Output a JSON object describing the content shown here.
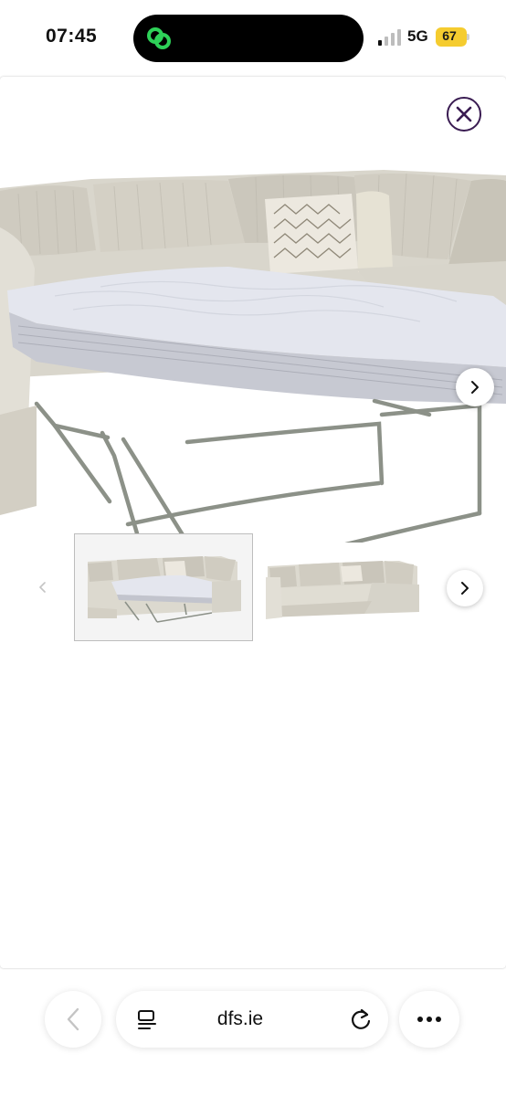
{
  "status_bar": {
    "time": "07:45",
    "network": "5G",
    "battery_level": "67",
    "battery_color": "#f5cc2f",
    "activity_icon": "link-rings-icon",
    "activity_color": "#2ed158"
  },
  "web_page": {
    "close_icon": "close-icon",
    "accent_color": "#3a1c52",
    "main_image": {
      "subject": "corner sofa bed with mattress pulled out",
      "next_icon": "chevron-right-icon"
    },
    "thumbnails": {
      "prev_icon": "chevron-left-icon",
      "items": [
        {
          "subject": "corner sofa bed open",
          "selected": true
        },
        {
          "subject": "corner sofa closed",
          "selected": false
        }
      ],
      "next_icon": "chevron-right-icon"
    }
  },
  "browser_toolbar": {
    "back_icon": "chevron-left-icon",
    "reader_icon": "page-menu-icon",
    "url": "dfs.ie",
    "reload_icon": "reload-icon",
    "more_icon": "more-dots-icon"
  }
}
